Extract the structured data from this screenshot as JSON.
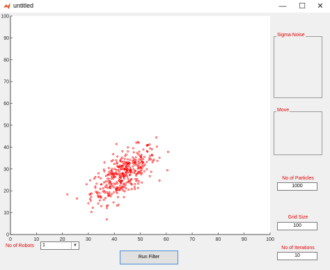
{
  "window": {
    "title": "untitled",
    "minimize_icon": "minimize-icon",
    "maximize_icon": "maximize-icon",
    "close_icon": "close-icon"
  },
  "axes": {
    "xlim": [
      0,
      100
    ],
    "ylim": [
      0,
      100
    ],
    "xticks": [
      "0",
      "10",
      "20",
      "30",
      "40",
      "50",
      "60",
      "70",
      "80",
      "90",
      "100"
    ],
    "yticks": [
      "0",
      "10",
      "20",
      "30",
      "40",
      "50",
      "60",
      "70",
      "80",
      "90",
      "100"
    ],
    "marker": "circle-open",
    "marker_color": "#ff0000"
  },
  "chart_data": {
    "type": "scatter",
    "xlim": [
      0,
      100
    ],
    "ylim": [
      0,
      100
    ],
    "grid": false,
    "series": [
      {
        "color": "#ff0000",
        "points": []
      }
    ]
  },
  "panels": {
    "sigma_noise_title": "Sigma Noise",
    "move_title": "Move"
  },
  "controls": {
    "particles_label": "No of Particles",
    "particles_value": "1000",
    "grid_label": "Grid Size",
    "grid_value": "100",
    "iterations_label": "No of Iterations",
    "iterations_value": "10",
    "robots_label": "No of Robots",
    "robots_value": "1",
    "run_button": "Run Filter"
  }
}
